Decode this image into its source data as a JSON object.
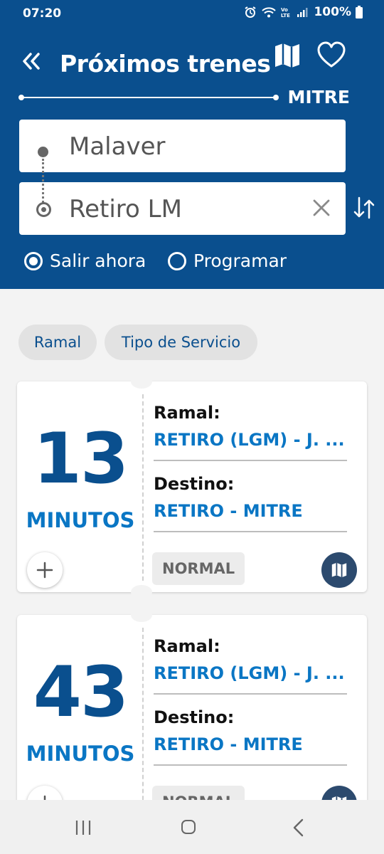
{
  "status_bar": {
    "time": "07:20",
    "battery": "100%"
  },
  "header": {
    "title": "Próximos trenes",
    "line_name": "MITRE",
    "origin": "Malaver",
    "destination": "Retiro LM",
    "options": [
      {
        "label": "Salir ahora",
        "selected": true
      },
      {
        "label": "Programar",
        "selected": false
      }
    ]
  },
  "filters": [
    "Ramal",
    "Tipo de Servicio"
  ],
  "trains": [
    {
      "minutes": "13",
      "unit": "MINUTOS",
      "ramal_label": "Ramal:",
      "ramal": "RETIRO (LGM) - J. ...",
      "destino_label": "Destino:",
      "destino": "RETIRO - MITRE",
      "service": "NORMAL"
    },
    {
      "minutes": "43",
      "unit": "MINUTOS",
      "ramal_label": "Ramal:",
      "ramal": "RETIRO (LGM) - J. ...",
      "destino_label": "Destino:",
      "destino": "RETIRO - MITRE",
      "service": "NORMAL"
    }
  ],
  "colors": {
    "primary": "#0a4f8e",
    "accent": "#0a76c4",
    "map_button": "#2c4a6e"
  },
  "icons": [
    "back-double-chevron-icon",
    "map-icon",
    "heart-icon",
    "clear-icon",
    "swap-icon",
    "plus-icon"
  ]
}
